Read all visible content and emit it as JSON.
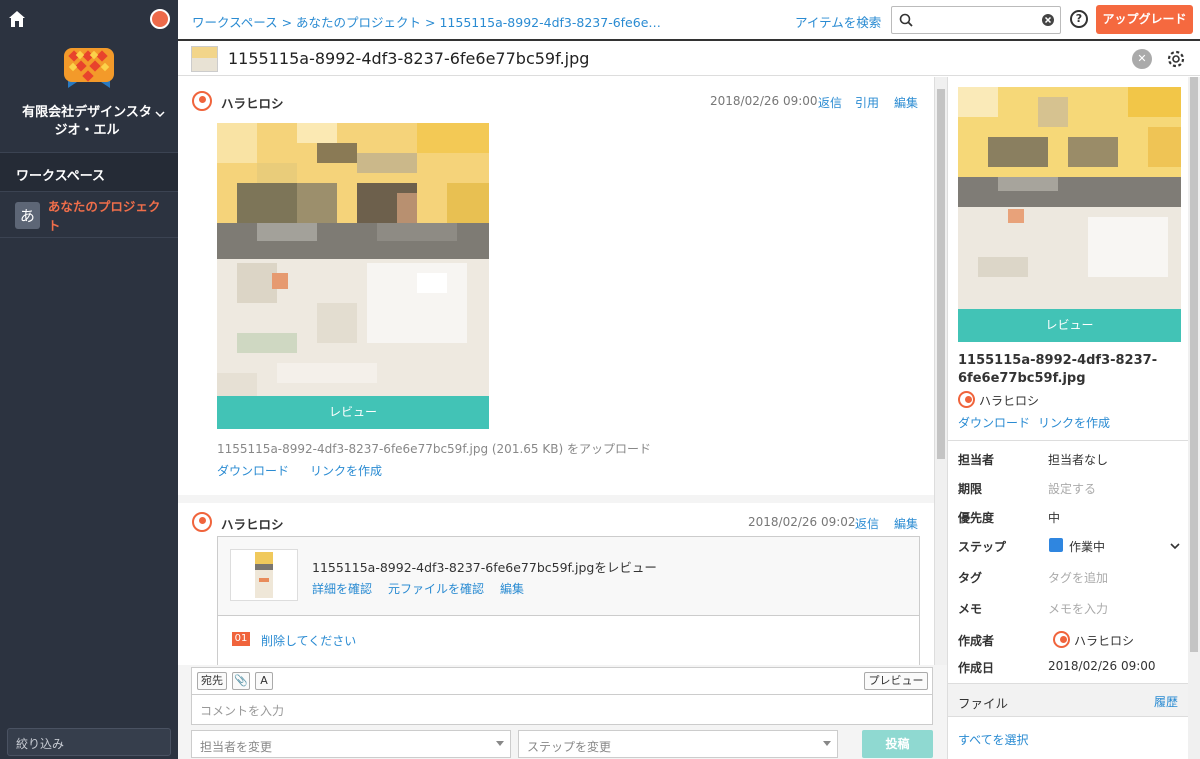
{
  "sidebar": {
    "org_name": "有限会社デザインスタジオ・エル",
    "workspace": "ワークスペース",
    "project_badge": "あ",
    "project_label": "あなたのプロジェクト",
    "filter": "絞り込み"
  },
  "topbar": {
    "breadcrumb": "ワークスペース > あなたのプロジェクト > 1155115a-8992-4df3-8237-6fe6e…",
    "search_items": "アイテムを検索",
    "search_placeholder": "",
    "help": "?",
    "upgrade": "アップグレード"
  },
  "file": {
    "title": "1155115a-8992-4df3-8237-6fe6e77bc59f.jpg"
  },
  "posts": [
    {
      "user": "ハラヒロシ",
      "timestamp": "2018/02/26 09:00",
      "actions": [
        "返信",
        "引用",
        "編集"
      ],
      "review_label": "レビュー",
      "upload_text": "1155115a-8992-4df3-8237-6fe6e77bc59f.jpg (201.65 KB) をアップロード",
      "links": [
        "ダウンロード",
        "リンクを作成"
      ]
    },
    {
      "user": "ハラヒロシ",
      "timestamp": "2018/02/26 09:02",
      "actions": [
        "返信",
        "編集"
      ],
      "review_title": "1155115a-8992-4df3-8237-6fe6e77bc59f.jpgをレビュー",
      "review_links": [
        "詳細を確認",
        "元ファイルを確認",
        "編集"
      ],
      "comment_number": "01",
      "comment_text": "削除してください"
    }
  ],
  "composer": {
    "to": "宛先",
    "font": "A",
    "preview": "プレビュー",
    "placeholder": "コメントを入力",
    "assignee_select": "担当者を変更",
    "step_select": "ステップを変更",
    "post": "投稿"
  },
  "panel": {
    "review_label": "レビュー",
    "filename": "1155115a-8992-4df3-8237-6fe6e77bc59f.jpg",
    "user": "ハラヒロシ",
    "links": [
      "ダウンロード",
      "リンクを作成"
    ],
    "props": {
      "assignee_k": "担当者",
      "assignee_v": "担当者なし",
      "due_k": "期限",
      "due_v": "設定する",
      "priority_k": "優先度",
      "priority_v": "中",
      "step_k": "ステップ",
      "step_v": "作業中",
      "tag_k": "タグ",
      "tag_v": "タグを追加",
      "memo_k": "メモ",
      "memo_v": "メモを入力",
      "creator_k": "作成者",
      "creator_v": "ハラヒロシ",
      "created_k": "作成日",
      "created_v": "2018/02/26 09:00"
    },
    "files_heading": "ファイル",
    "history": "履歴",
    "select_all": "すべてを選択"
  },
  "colors": {
    "sidebar_bg": "#2c3340",
    "accent_orange": "#f5693f",
    "review_teal": "#42c3b6",
    "link_blue": "#2a8bd2",
    "step_blue": "#2f86e0"
  }
}
